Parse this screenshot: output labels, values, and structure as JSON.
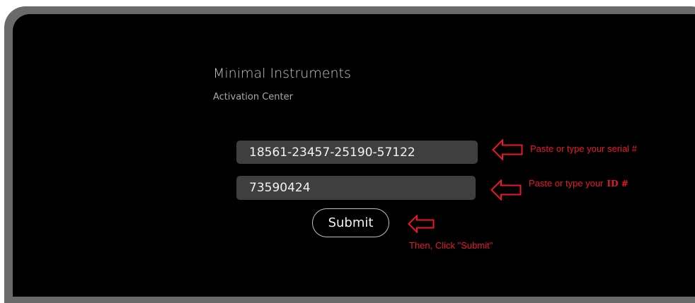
{
  "app": {
    "title": "Minimal Instruments",
    "subtitle": "Activation Center"
  },
  "form": {
    "serial_value": "18561-23457-25190-57122",
    "id_value": "73590424",
    "submit_label": "Submit"
  },
  "annotations": {
    "serial_note": "Paste or type your serial #",
    "id_note_prefix": "Paste or type your",
    "id_note_code": "ID #",
    "submit_note": "Then, Click \"Submit\""
  },
  "colors": {
    "background": "#000000",
    "bezel": "#6a6a6a",
    "field_bg": "#3f3f3f",
    "annotation": "#e8182a"
  },
  "icons": {
    "serial_arrow": "left-arrow-icon",
    "id_arrow": "left-arrow-icon",
    "submit_arrow": "left-arrow-icon"
  }
}
